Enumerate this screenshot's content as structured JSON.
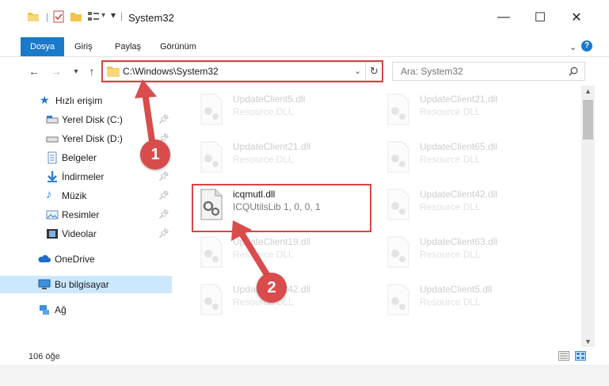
{
  "window": {
    "title": "System32",
    "controls": {
      "minimize": "—",
      "maximize": "☐",
      "close": "✕"
    }
  },
  "ribbon": {
    "tabs": [
      {
        "label": "Dosya",
        "active": true
      },
      {
        "label": "Giriş",
        "active": false
      },
      {
        "label": "Paylaş",
        "active": false
      },
      {
        "label": "Görünüm",
        "active": false
      }
    ],
    "help": "?"
  },
  "address": {
    "path": "C:\\Windows\\System32",
    "search_placeholder": "Ara: System32"
  },
  "sidebar": {
    "quick_access": "Hızlı erişim",
    "items": [
      {
        "label": "Yerel Disk (C:)",
        "icon": "drive-icon"
      },
      {
        "label": "Yerel Disk (D:)",
        "icon": "drive-icon"
      },
      {
        "label": "Belgeler",
        "icon": "documents-icon"
      },
      {
        "label": "İndirmeler",
        "icon": "downloads-icon"
      },
      {
        "label": "Müzik",
        "icon": "music-icon"
      },
      {
        "label": "Resimler",
        "icon": "pictures-icon"
      },
      {
        "label": "Videolar",
        "icon": "videos-icon"
      }
    ],
    "onedrive": "OneDrive",
    "this_pc": "Bu bilgisayar",
    "network": "Ağ"
  },
  "files": {
    "left": [
      {
        "name": "UpdateClient5.dll",
        "desc": "Resource DLL"
      },
      {
        "name": "UpdateClient21.dll",
        "desc": "Resource DLL"
      },
      {
        "name": "icqmutl.dll",
        "desc": "ICQUtilsLib 1, 0, 0, 1"
      },
      {
        "name": "UpdateClient19.dll",
        "desc": "Resource DLL"
      },
      {
        "name": "UpdateClient42.dll",
        "desc": "Resource DLL"
      }
    ],
    "right": [
      {
        "name": "UpdateClient21.dll",
        "desc": "Resource DLL"
      },
      {
        "name": "UpdateClient65.dll",
        "desc": "Resource DLL"
      },
      {
        "name": "UpdateClient42.dll",
        "desc": "Resource DLL"
      },
      {
        "name": "UpdateClient63.dll",
        "desc": "Resource DLL"
      },
      {
        "name": "UpdateClient5.dll",
        "desc": "Resource DLL"
      }
    ]
  },
  "status": {
    "count": "106 öğe"
  },
  "annotations": {
    "step1": "1",
    "step2": "2",
    "color": "#d94c4c"
  },
  "colors": {
    "accent": "#1979ca",
    "selected": "#cce8ff",
    "folder": "#f4c34e"
  }
}
